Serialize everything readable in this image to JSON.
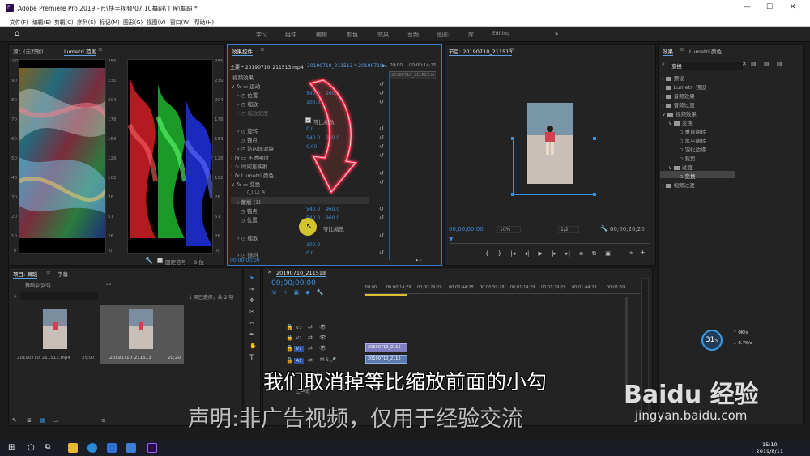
{
  "window": {
    "title": "Adobe Premiere Pro 2019 - F:\\快手视频\\07.10舞蹈\\工程\\舞蹈 *",
    "min_label": "—",
    "max_label": "☐",
    "close_label": "✕"
  },
  "menu": [
    "文件(F)",
    "编辑(E)",
    "剪辑(C)",
    "序列(S)",
    "标记(M)",
    "图形(G)",
    "视图(V)",
    "窗口(W)",
    "帮助(H)"
  ],
  "workspaces": [
    "学习",
    "组件",
    "编辑",
    "颜色",
    "效果",
    "音频",
    "图形",
    "库",
    "Editing"
  ],
  "scopes": {
    "tab_source": "源：(无剪辑)",
    "tab_lumetri": "Lumetri 范围",
    "left_scale": [
      "100",
      "90",
      "80",
      "70",
      "60",
      "50",
      "40",
      "30",
      "20",
      "10",
      "0"
    ],
    "mid_scale": [
      "255",
      "230",
      "204",
      "178",
      "153",
      "128",
      "102",
      "76",
      "51",
      "26",
      "0"
    ],
    "right_scale": [
      "255",
      "230",
      "204",
      "178",
      "153",
      "128",
      "102",
      "76",
      "51",
      "26",
      "0"
    ],
    "footer_label": "固定信号",
    "footer_bits": "8 位"
  },
  "effect_controls": {
    "tab": "效果控件",
    "master_clip": "主要 * 20190710_211513.mp4",
    "sequence_clip": "20190710_211513 * 20190710...",
    "time_start": "00;00",
    "time_end": "00;00;14;25",
    "ruler_clip": "20190710_211513.m",
    "video_effects": "视频效果",
    "motion": "运动",
    "position": "位置",
    "position_x": "540.0",
    "position_y": "960.0",
    "scale": "缩放",
    "scale_val": "100.0",
    "scale_width": "缩放宽度",
    "uniform_scale": "等比缩放",
    "rotation": "旋转",
    "rotation_val": "0.0",
    "anchor": "锚点",
    "anchor_x": "540.0",
    "anchor_y": "960.0",
    "anti_flicker": "防闪烁滤镜",
    "anti_flicker_val": "0.00",
    "opacity": "不透明度",
    "time_remap": "时间重映射",
    "lumetri": "Lumetri 颜色",
    "transform": "变换",
    "shape_heading": "蒙版 (1)",
    "anchor2": "锚点",
    "anchor2_x": "540.0",
    "anchor2_y": "960.0",
    "position2": "位置",
    "position2_x": "540.0",
    "position2_y": "960.0",
    "uniform_scale2": "等比缩放",
    "scale2": "缩放",
    "scale2_val": "100.0",
    "skew": "倾斜",
    "skew_val": "0.0",
    "timecode": "00;00;00;00"
  },
  "program": {
    "tab": "节目: 20190710_211513",
    "timecode_left": "00;00;00;00",
    "zoom": "10%",
    "quality": "1/2",
    "timecode_right": "00;00;20;20"
  },
  "effects_panel": {
    "tab_effects": "效果",
    "tab_lumetri": "Lumetri 颜色",
    "search_value": "变换",
    "tree": [
      "预设",
      "Lumetri 预设",
      "音频效果",
      "音频过渡",
      "视频效果",
      "变换",
      "垂直翻转",
      "水平翻转",
      "羽化边缘",
      "裁剪",
      "过渡",
      "变换",
      "视频过渡"
    ]
  },
  "project": {
    "tab_project": "项目: 舞蹈",
    "tab_media": "字幕",
    "file": "舞蹈.prproj",
    "selection_info": "1 项已选择，共 2 项",
    "items": [
      {
        "name": "20190710_211513.mp4",
        "duration": "25;07"
      },
      {
        "name": "20190710_211513",
        "duration": "20;20"
      }
    ]
  },
  "timeline": {
    "tab": "20190710_211513",
    "timecode": "00;00;00;00",
    "ruler": [
      ":00;00",
      "00;00;14;29",
      "00;00;29;29",
      "00;00;44;28",
      "00;00;59;28",
      "00;01;14;29",
      "00;01;29;29",
      "00;01;44;28",
      "00;01;59"
    ],
    "tracks": [
      "V3",
      "V2",
      "V1",
      "A1"
    ],
    "clip_video": "20190710_2115",
    "clip_audio": "20190710_2115",
    "master": "主声道",
    "master_val": "0.0"
  },
  "gauge": {
    "percent": "31",
    "unit": "%",
    "up_rate": "0",
    "up_unit": "K/s",
    "down_rate": "0.7",
    "down_unit": "K/s"
  },
  "caption": "我们取消掉等比缩放前面的小勾",
  "disclaimer": "声明:非广告视频，仅用于经验交流",
  "watermark": {
    "brand": "Baidu 经验",
    "url": "jingyan.baidu.com"
  },
  "taskbar": {
    "time": "15:10",
    "date": "2019/8/11"
  },
  "colors": {
    "accent": "#3b8edc",
    "arrow": "#ff2d4a",
    "cursor": "#f0e030"
  }
}
